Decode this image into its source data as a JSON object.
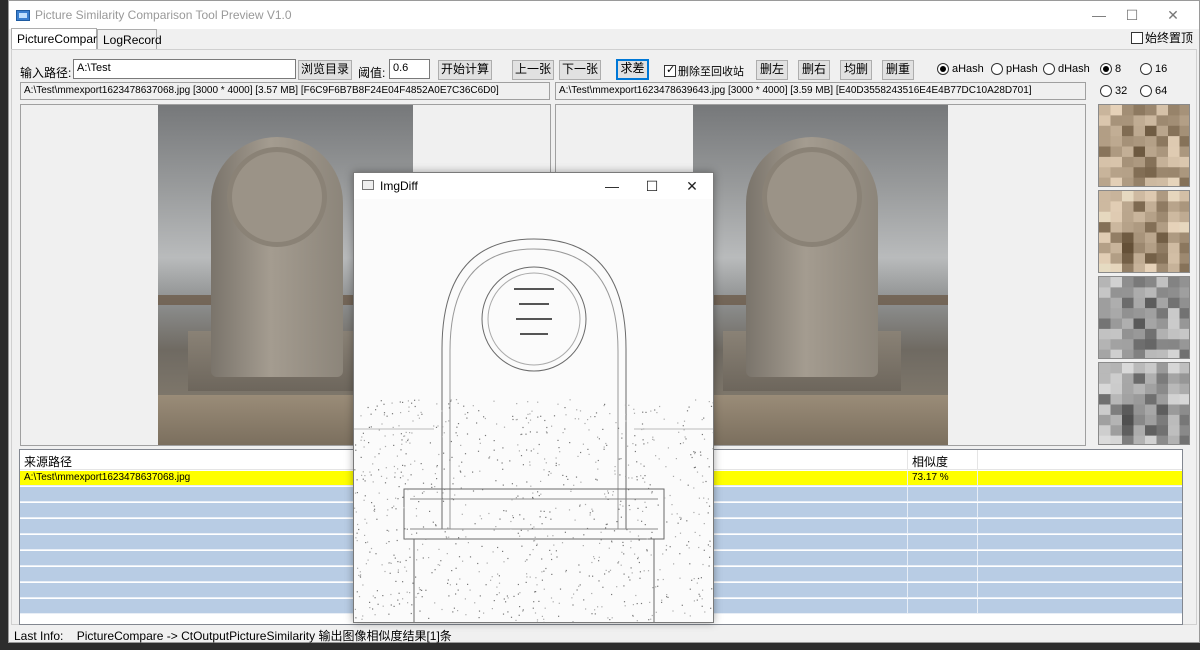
{
  "window": {
    "title": "Picture Similarity Comparison Tool Preview V1.0",
    "minimize": "—",
    "maximize": "☐",
    "close": "✕"
  },
  "tabs": [
    {
      "label": "PictureCompare",
      "active": true
    },
    {
      "label": "LogRecord",
      "active": false
    }
  ],
  "always_on_top": {
    "label": "始终置顶",
    "checked": false
  },
  "toolbar": {
    "path_label": "输入路径:",
    "path_value": "A:\\Test",
    "browse_button": "浏览目录",
    "threshold_label": "阈值:",
    "threshold_value": "0.6",
    "start_button": "开始计算",
    "prev_button": "上一张",
    "next_button": "下一张",
    "diff_button": "求差",
    "recycle_label": "删除至回收站",
    "recycle_checked": true,
    "delete_left_button": "删左",
    "delete_right_button": "删右",
    "delete_both_button": "均删",
    "delete_dup_button": "删重"
  },
  "hash_options": [
    {
      "label": "aHash",
      "selected": true
    },
    {
      "label": "pHash",
      "selected": false
    },
    {
      "label": "dHash",
      "selected": false
    }
  ],
  "size_options": [
    {
      "label": "8",
      "selected": true
    },
    {
      "label": "16",
      "selected": false
    },
    {
      "label": "32",
      "selected": false
    },
    {
      "label": "64",
      "selected": false
    }
  ],
  "left_info": "A:\\Test\\mmexport1623478637068.jpg [3000 * 4000] [3.57 MB] [F6C9F6B7B8F24E04F4852A0E7C36C6D0]",
  "right_info": "A:\\Test\\mmexport1623478639643.jpg [3000 * 4000] [3.59 MB] [E40D3558243516E4E4B77DC10A28D701]",
  "table": {
    "col_source": "来源路径",
    "col_similarity": "相似度",
    "rows": [
      {
        "source": "A:\\Test\\mmexport1623478637068.jpg",
        "similarity": "73.17 %"
      }
    ],
    "empty_rows": 8
  },
  "status": {
    "label": "Last Info:",
    "text": "PictureCompare -> CtOutputPictureSimilarity  输出图像相似度结果[1]条"
  },
  "popup": {
    "title": "ImgDiff",
    "minimize": "—",
    "maximize": "☐",
    "close": "✕"
  },
  "colors": {
    "selected_row": "#ffff00",
    "row_bg": "#b8cce4",
    "focus_border": "#0078d7"
  }
}
